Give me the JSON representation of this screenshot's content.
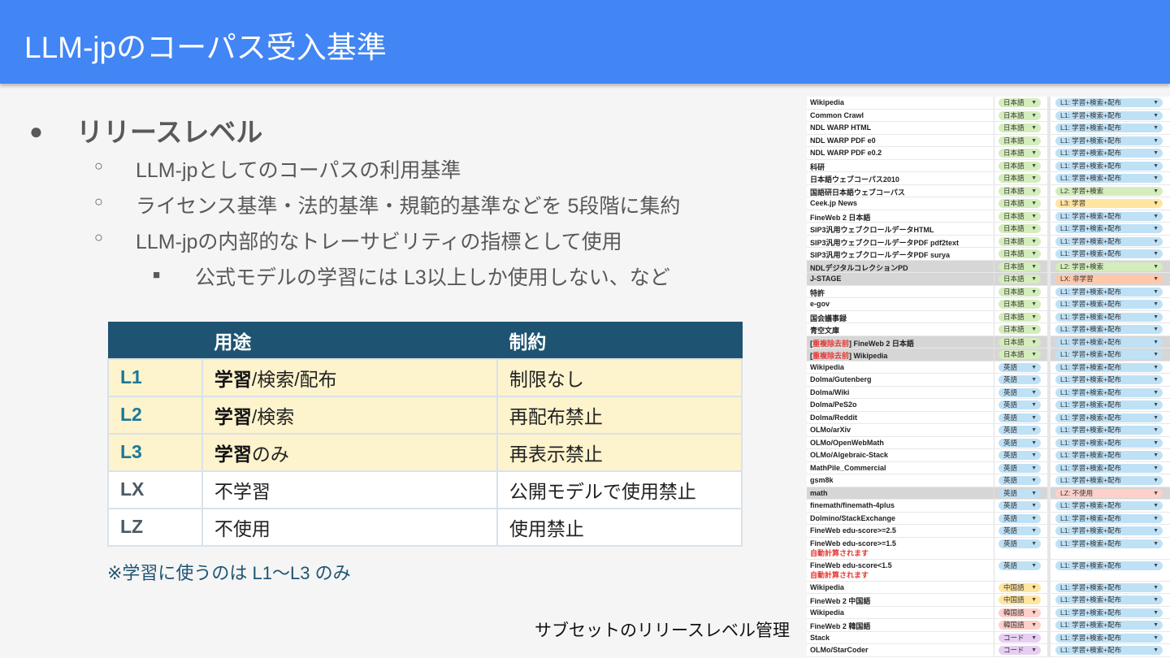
{
  "title": "LLM-jpのコーパス受入基準",
  "bullets": {
    "main": "リリースレベル",
    "sub": [
      "LLM-jpとしてのコーパスの利用基準",
      "ライセンス基準・法的基準・規範的基準などを 5段階に集約",
      "LLM-jpの内部的なトレーサビリティの指標として使用"
    ],
    "subsub": "公式モデルの学習には L3以上しか使用しない、など",
    "dot1": "●",
    "dot2": "○",
    "dot3": "■"
  },
  "table": {
    "headers": [
      "",
      "用途",
      "制約"
    ],
    "rows": [
      {
        "level": "L1",
        "use_bold": "学習",
        "use_rest": "/検索/配布",
        "limit": "制限なし"
      },
      {
        "level": "L2",
        "use_bold": "学習",
        "use_rest": "/検索",
        "limit": "再配布禁止"
      },
      {
        "level": "L3",
        "use_bold": "学習",
        "use_rest": "のみ",
        "limit": "再表示禁止"
      },
      {
        "level": "LX",
        "use_bold": "",
        "use_rest": "不学習",
        "limit": "公開モデルで使用禁止"
      },
      {
        "level": "LZ",
        "use_bold": "",
        "use_rest": "不使用",
        "limit": "使用禁止"
      }
    ]
  },
  "note": "※学習に使うのは L1〜L3 のみ",
  "caption": "サブセットのリリースレベル管理",
  "colors": {
    "header_bg": "#4285f4",
    "table_header": "#1e5472",
    "highlight_row": "#fdf3cd",
    "chip_ja": "#d4edbc",
    "chip_en": "#bfe1f6",
    "chip_zh": "#ffe5a0",
    "chip_ko": "#ffcfc9",
    "chip_code": "#e6cff2",
    "chip_L1": "#bfe1f6",
    "chip_L2": "#d4edbc",
    "chip_L3": "#ffe5a0",
    "chip_LX": "#ffc8aa",
    "chip_LZ": "#ffcfc9"
  },
  "sheet": {
    "rows": [
      {
        "pre": "",
        "red": "",
        "name": "Wikipedia",
        "lang": "日本語",
        "lang_key": "ja",
        "level": "L1: 学習+検索+配布",
        "level_key": "L1",
        "gray": false
      },
      {
        "pre": "",
        "red": "",
        "name": "Common Crawl",
        "lang": "日本語",
        "lang_key": "ja",
        "level": "L1: 学習+検索+配布",
        "level_key": "L1",
        "gray": false
      },
      {
        "pre": "",
        "red": "",
        "name": "NDL WARP HTML",
        "lang": "日本語",
        "lang_key": "ja",
        "level": "L1: 学習+検索+配布",
        "level_key": "L1",
        "gray": false
      },
      {
        "pre": "",
        "red": "",
        "name": "NDL WARP PDF e0",
        "lang": "日本語",
        "lang_key": "ja",
        "level": "L1: 学習+検索+配布",
        "level_key": "L1",
        "gray": false
      },
      {
        "pre": "",
        "red": "",
        "name": "NDL WARP PDF e0.2",
        "lang": "日本語",
        "lang_key": "ja",
        "level": "L1: 学習+検索+配布",
        "level_key": "L1",
        "gray": false
      },
      {
        "pre": "",
        "red": "",
        "name": "科研",
        "lang": "日本語",
        "lang_key": "ja",
        "level": "L1: 学習+検索+配布",
        "level_key": "L1",
        "gray": false
      },
      {
        "pre": "",
        "red": "",
        "name": "日本語ウェブコーパス2010",
        "lang": "日本語",
        "lang_key": "ja",
        "level": "L1: 学習+検索+配布",
        "level_key": "L1",
        "gray": false
      },
      {
        "pre": "",
        "red": "",
        "name": "国語研日本語ウェブコーパス",
        "lang": "日本語",
        "lang_key": "ja",
        "level": "L2: 学習+検索",
        "level_key": "L2",
        "gray": false
      },
      {
        "pre": "",
        "red": "",
        "name": "Ceek.jp News",
        "lang": "日本語",
        "lang_key": "ja",
        "level": "L3: 学習",
        "level_key": "L3",
        "gray": false
      },
      {
        "pre": "",
        "red": "",
        "name": "FineWeb 2 日本語",
        "lang": "日本語",
        "lang_key": "ja",
        "level": "L1: 学習+検索+配布",
        "level_key": "L1",
        "gray": false
      },
      {
        "pre": "",
        "red": "",
        "name": "SIP3汎用ウェブクロールデータHTML",
        "lang": "日本語",
        "lang_key": "ja",
        "level": "L1: 学習+検索+配布",
        "level_key": "L1",
        "gray": false
      },
      {
        "pre": "",
        "red": "",
        "name": "SIP3汎用ウェブクロールデータPDF pdf2text",
        "lang": "日本語",
        "lang_key": "ja",
        "level": "L1: 学習+検索+配布",
        "level_key": "L1",
        "gray": false
      },
      {
        "pre": "",
        "red": "",
        "name": "SIP3汎用ウェブクロールデータPDF surya",
        "lang": "日本語",
        "lang_key": "ja",
        "level": "L1: 学習+検索+配布",
        "level_key": "L1",
        "gray": false
      },
      {
        "pre": "",
        "red": "",
        "name": "NDLデジタルコレクションPD",
        "lang": "日本語",
        "lang_key": "ja",
        "level": "L2: 学習+検索",
        "level_key": "L2",
        "gray": true
      },
      {
        "pre": "",
        "red": "",
        "name": "J-STAGE",
        "lang": "日本語",
        "lang_key": "ja",
        "level": "LX: 非学習",
        "level_key": "LX",
        "gray": true
      },
      {
        "pre": "",
        "red": "",
        "name": "特許",
        "lang": "日本語",
        "lang_key": "ja",
        "level": "L1: 学習+検索+配布",
        "level_key": "L1",
        "gray": false
      },
      {
        "pre": "",
        "red": "",
        "name": "e-gov",
        "lang": "日本語",
        "lang_key": "ja",
        "level": "L1: 学習+検索+配布",
        "level_key": "L1",
        "gray": false
      },
      {
        "pre": "",
        "red": "",
        "name": "国会議事録",
        "lang": "日本語",
        "lang_key": "ja",
        "level": "L1: 学習+検索+配布",
        "level_key": "L1",
        "gray": false
      },
      {
        "pre": "",
        "red": "",
        "name": "青空文庫",
        "lang": "日本語",
        "lang_key": "ja",
        "level": "L1: 学習+検索+配布",
        "level_key": "L1",
        "gray": false
      },
      {
        "pre": "[",
        "red": "重複除去前",
        "name": "] FineWeb 2 日本語",
        "lang": "日本語",
        "lang_key": "ja",
        "level": "L1: 学習+検索+配布",
        "level_key": "L1",
        "gray": true
      },
      {
        "pre": "[",
        "red": "重複除去前",
        "name": "] Wikipedia",
        "lang": "日本語",
        "lang_key": "ja",
        "level": "L1: 学習+検索+配布",
        "level_key": "L1",
        "gray": true
      },
      {
        "pre": "",
        "red": "",
        "name": "Wikipedia",
        "lang": "英語",
        "lang_key": "en",
        "level": "L1: 学習+検索+配布",
        "level_key": "L1",
        "gray": false
      },
      {
        "pre": "",
        "red": "",
        "name": "Dolma/Gutenberg",
        "lang": "英語",
        "lang_key": "en",
        "level": "L1: 学習+検索+配布",
        "level_key": "L1",
        "gray": false
      },
      {
        "pre": "",
        "red": "",
        "name": "Dolma/Wiki",
        "lang": "英語",
        "lang_key": "en",
        "level": "L1: 学習+検索+配布",
        "level_key": "L1",
        "gray": false
      },
      {
        "pre": "",
        "red": "",
        "name": "Dolma/PeS2o",
        "lang": "英語",
        "lang_key": "en",
        "level": "L1: 学習+検索+配布",
        "level_key": "L1",
        "gray": false
      },
      {
        "pre": "",
        "red": "",
        "name": "Dolma/Reddit",
        "lang": "英語",
        "lang_key": "en",
        "level": "L1: 学習+検索+配布",
        "level_key": "L1",
        "gray": false
      },
      {
        "pre": "",
        "red": "",
        "name": "OLMo/arXiv",
        "lang": "英語",
        "lang_key": "en",
        "level": "L1: 学習+検索+配布",
        "level_key": "L1",
        "gray": false
      },
      {
        "pre": "",
        "red": "",
        "name": "OLMo/OpenWebMath",
        "lang": "英語",
        "lang_key": "en",
        "level": "L1: 学習+検索+配布",
        "level_key": "L1",
        "gray": false
      },
      {
        "pre": "",
        "red": "",
        "name": "OLMo/Algebraic-Stack",
        "lang": "英語",
        "lang_key": "en",
        "level": "L1: 学習+検索+配布",
        "level_key": "L1",
        "gray": false
      },
      {
        "pre": "",
        "red": "",
        "name": "MathPile_Commercial",
        "lang": "英語",
        "lang_key": "en",
        "level": "L1: 学習+検索+配布",
        "level_key": "L1",
        "gray": false
      },
      {
        "pre": "",
        "red": "",
        "name": "gsm8k",
        "lang": "英語",
        "lang_key": "en",
        "level": "L1: 学習+検索+配布",
        "level_key": "L1",
        "gray": false
      },
      {
        "pre": "",
        "red": "",
        "name": "math",
        "lang": "英語",
        "lang_key": "en",
        "level": "LZ: 不使用",
        "level_key": "LZ",
        "gray": true
      },
      {
        "pre": "",
        "red": "",
        "name": "finemath/finemath-4plus",
        "lang": "英語",
        "lang_key": "en",
        "level": "L1: 学習+検索+配布",
        "level_key": "L1",
        "gray": false
      },
      {
        "pre": "",
        "red": "",
        "name": "Dolmino/StackExchange",
        "lang": "英語",
        "lang_key": "en",
        "level": "L1: 学習+検索+配布",
        "level_key": "L1",
        "gray": false
      },
      {
        "pre": "",
        "red": "",
        "name": "FineWeb edu-score>=2.5",
        "lang": "英語",
        "lang_key": "en",
        "level": "L1: 学習+検索+配布",
        "level_key": "L1",
        "gray": false
      },
      {
        "pre": "",
        "red": "",
        "name": "FineWeb edu-score>=1.5",
        "lang": "英語",
        "lang_key": "en",
        "level": "L1: 学習+検索+配布",
        "level_key": "L1",
        "gray": false,
        "auto": "自動計算されます"
      },
      {
        "pre": "",
        "red": "",
        "name": "FineWeb edu-score<1.5",
        "lang": "英語",
        "lang_key": "en",
        "level": "L1: 学習+検索+配布",
        "level_key": "L1",
        "gray": false,
        "auto": "自動計算されます"
      },
      {
        "pre": "",
        "red": "",
        "name": "Wikipedia",
        "lang": "中国語",
        "lang_key": "zh",
        "level": "L1: 学習+検索+配布",
        "level_key": "L1",
        "gray": false
      },
      {
        "pre": "",
        "red": "",
        "name": "FineWeb 2 中国語",
        "lang": "中国語",
        "lang_key": "zh",
        "level": "L1: 学習+検索+配布",
        "level_key": "L1",
        "gray": false
      },
      {
        "pre": "",
        "red": "",
        "name": "Wikipedia",
        "lang": "韓国語",
        "lang_key": "ko",
        "level": "L1: 学習+検索+配布",
        "level_key": "L1",
        "gray": false
      },
      {
        "pre": "",
        "red": "",
        "name": "FineWeb 2 韓国語",
        "lang": "韓国語",
        "lang_key": "ko",
        "level": "L1: 学習+検索+配布",
        "level_key": "L1",
        "gray": false
      },
      {
        "pre": "",
        "red": "",
        "name": "Stack",
        "lang": "コード",
        "lang_key": "code",
        "level": "L1: 学習+検索+配布",
        "level_key": "L1",
        "gray": false
      },
      {
        "pre": "",
        "red": "",
        "name": "OLMo/StarCoder",
        "lang": "コード",
        "lang_key": "code",
        "level": "L1: 学習+検索+配布",
        "level_key": "L1",
        "gray": false
      }
    ]
  }
}
